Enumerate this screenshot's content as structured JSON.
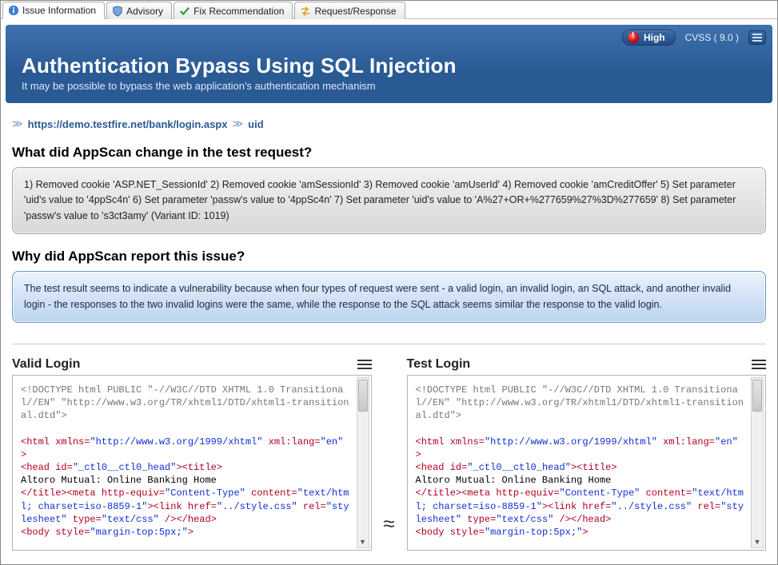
{
  "tabs": [
    {
      "label": "Issue Information",
      "icon": "info-icon"
    },
    {
      "label": "Advisory",
      "icon": "shield-icon"
    },
    {
      "label": "Fix Recommendation",
      "icon": "check-icon"
    },
    {
      "label": "Request/Response",
      "icon": "arrows-icon"
    }
  ],
  "active_tab": 0,
  "severity": {
    "label": "High"
  },
  "cvss": {
    "text": "CVSS  ( 9.0 )"
  },
  "title": "Authentication Bypass Using SQL Injection",
  "subtitle": "It may be possible to bypass the web application's authentication mechanism",
  "breadcrumb": {
    "url": "https://demo.testfire.net/bank/login.aspx",
    "param": "uid"
  },
  "section1": {
    "heading": "What did AppScan change in the test request?",
    "body": "1) Removed cookie 'ASP.NET_SessionId' 2) Removed cookie 'amSessionId' 3) Removed cookie 'amUserId' 4) Removed cookie 'amCreditOffer' 5) Set parameter 'uid's value to '4ppSc4n' 6) Set parameter 'passw's value to '4ppSc4n' 7) Set parameter 'uid's value to 'A%27+OR+%277659%27%3D%277659' 8) Set parameter 'passw's value to 's3ct3amy' (Variant ID: 1019)"
  },
  "section2": {
    "heading": "Why did AppScan report this issue?",
    "body": "The test result seems to indicate a vulnerability because when four types of request were sent - a valid login, an invalid login, an SQL attack, and another invalid login - the responses to the two invalid logins were the same, while the response to the SQL attack seems similar the response to the valid login."
  },
  "panels": {
    "left_title": "Valid Login",
    "right_title": "Test Login",
    "approx_symbol": "≈"
  },
  "code_lines": {
    "l1": "<!DOCTYPE html PUBLIC \"-//W3C//DTD XHTML 1.0 Transitional//EN\" \"http://www.w3.org/TR/xhtml1/DTD/xhtml1-transitional.dtd\">",
    "l2a": "<html ",
    "l2b": "xmlns",
    "l2c": "=",
    "l2d": "\"http://www.w3.org/1999/xhtml\"",
    "l2e": " xml:lang",
    "l2f": "\"en\"",
    "l2g": " >",
    "l3a": "<head ",
    "l3b": "id",
    "l3c": "\"_ctl0__ctl0_head\"",
    "l3d": "><title>",
    "l4": "Altoro Mutual: Online Banking Home",
    "l5a": "</title><meta ",
    "l5b": "http-equiv",
    "l5c": "\"Content-Type\"",
    "l5d": " content",
    "l5e": "\"text/html; charset=iso-8859-1\"",
    "l5f": "><link ",
    "l5g": "href",
    "l5h": "\"../style.css\"",
    "l5i": " rel",
    "l5j": "\"stylesheet\"",
    "l5k": " type",
    "l5l": "\"text/css\"",
    "l5m": " /></head>",
    "l6a": "<body ",
    "l6b": "style",
    "l6c": "\"margin-top:5px;\"",
    "l6d": ">"
  }
}
